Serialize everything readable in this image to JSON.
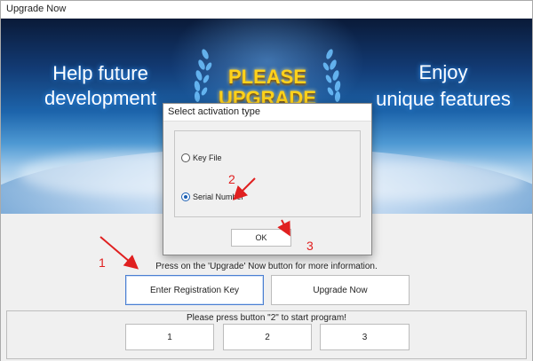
{
  "window": {
    "title": "Upgrade Now"
  },
  "banner": {
    "left_line1": "Help future",
    "left_line2": "development",
    "center_line1": "PLEASE",
    "center_line2": "UPGRADE",
    "right_line1": "Enjoy",
    "right_line2": "unique features"
  },
  "main": {
    "info_text": "Press on the 'Upgrade' Now button for more information.",
    "enter_key_label": "Enter Registration Key",
    "upgrade_label": "Upgrade Now",
    "group_text": "Please press button \"2\" to start program!",
    "buttons": [
      "1",
      "2",
      "3"
    ]
  },
  "dialog": {
    "title": "Select activation type",
    "options": [
      {
        "label": "Key File",
        "selected": false
      },
      {
        "label": "Serial Number",
        "selected": true
      }
    ],
    "ok_label": "OK"
  },
  "annotations": {
    "step1": "1",
    "step2": "2",
    "step3": "3",
    "color": "#e02020"
  }
}
